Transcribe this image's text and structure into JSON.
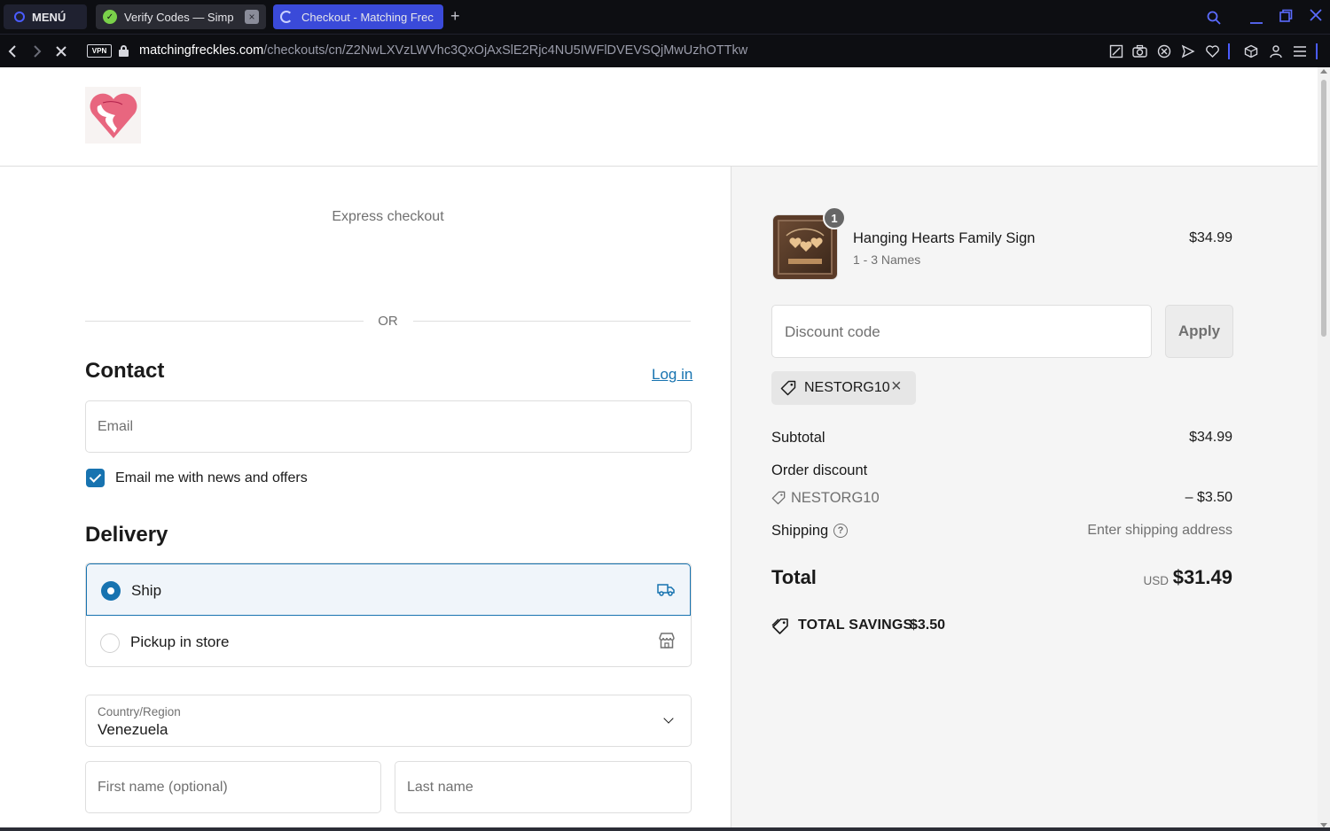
{
  "browser": {
    "menu_label": "MENÚ",
    "tabs": [
      {
        "title": "Verify Codes — Simp"
      },
      {
        "title": "Checkout - Matching Frec"
      }
    ],
    "new_tab": "+",
    "url_host": "matchingfreckles.com",
    "url_path": "/checkouts/cn/Z2NwLXVzLWVhc3QxOjAxSlE2Rjc4NU5IWFlDVEVSQjMwUzhOTTkw",
    "vpn_label": "VPN"
  },
  "checkout": {
    "express_checkout": "Express checkout",
    "or_label": "OR",
    "contact": {
      "heading": "Contact",
      "login_link": "Log in",
      "email_placeholder": "Email",
      "newsletter_label": "Email me with news and offers",
      "newsletter_checked": true
    },
    "delivery": {
      "heading": "Delivery",
      "options": [
        {
          "label": "Ship",
          "selected": true,
          "icon": "truck-icon"
        },
        {
          "label": "Pickup in store",
          "selected": false,
          "icon": "store-icon"
        }
      ],
      "country_label": "Country/Region",
      "country_value": "Venezuela",
      "first_name_placeholder": "First name (optional)",
      "last_name_placeholder": "Last name"
    }
  },
  "summary": {
    "product": {
      "name": "Hanging Hearts Family Sign",
      "variant": "1 - 3 Names",
      "price": "$34.99",
      "quantity": "1"
    },
    "discount_placeholder": "Discount code",
    "apply_label": "Apply",
    "applied_code": "NESTORG10",
    "subtotal_label": "Subtotal",
    "subtotal_value": "$34.99",
    "order_discount_label": "Order discount",
    "discount_code": "NESTORG10",
    "discount_value": "– $3.50",
    "shipping_label": "Shipping",
    "shipping_value": "Enter shipping address",
    "total_label": "Total",
    "total_currency": "USD",
    "total_value": "$31.49",
    "savings_label": "TOTAL SAVINGS",
    "savings_value": "$3.50"
  },
  "colors": {
    "accent": "#1773b0",
    "browser_bg": "#0d0e12",
    "active_tab": "#3a4ad9"
  }
}
